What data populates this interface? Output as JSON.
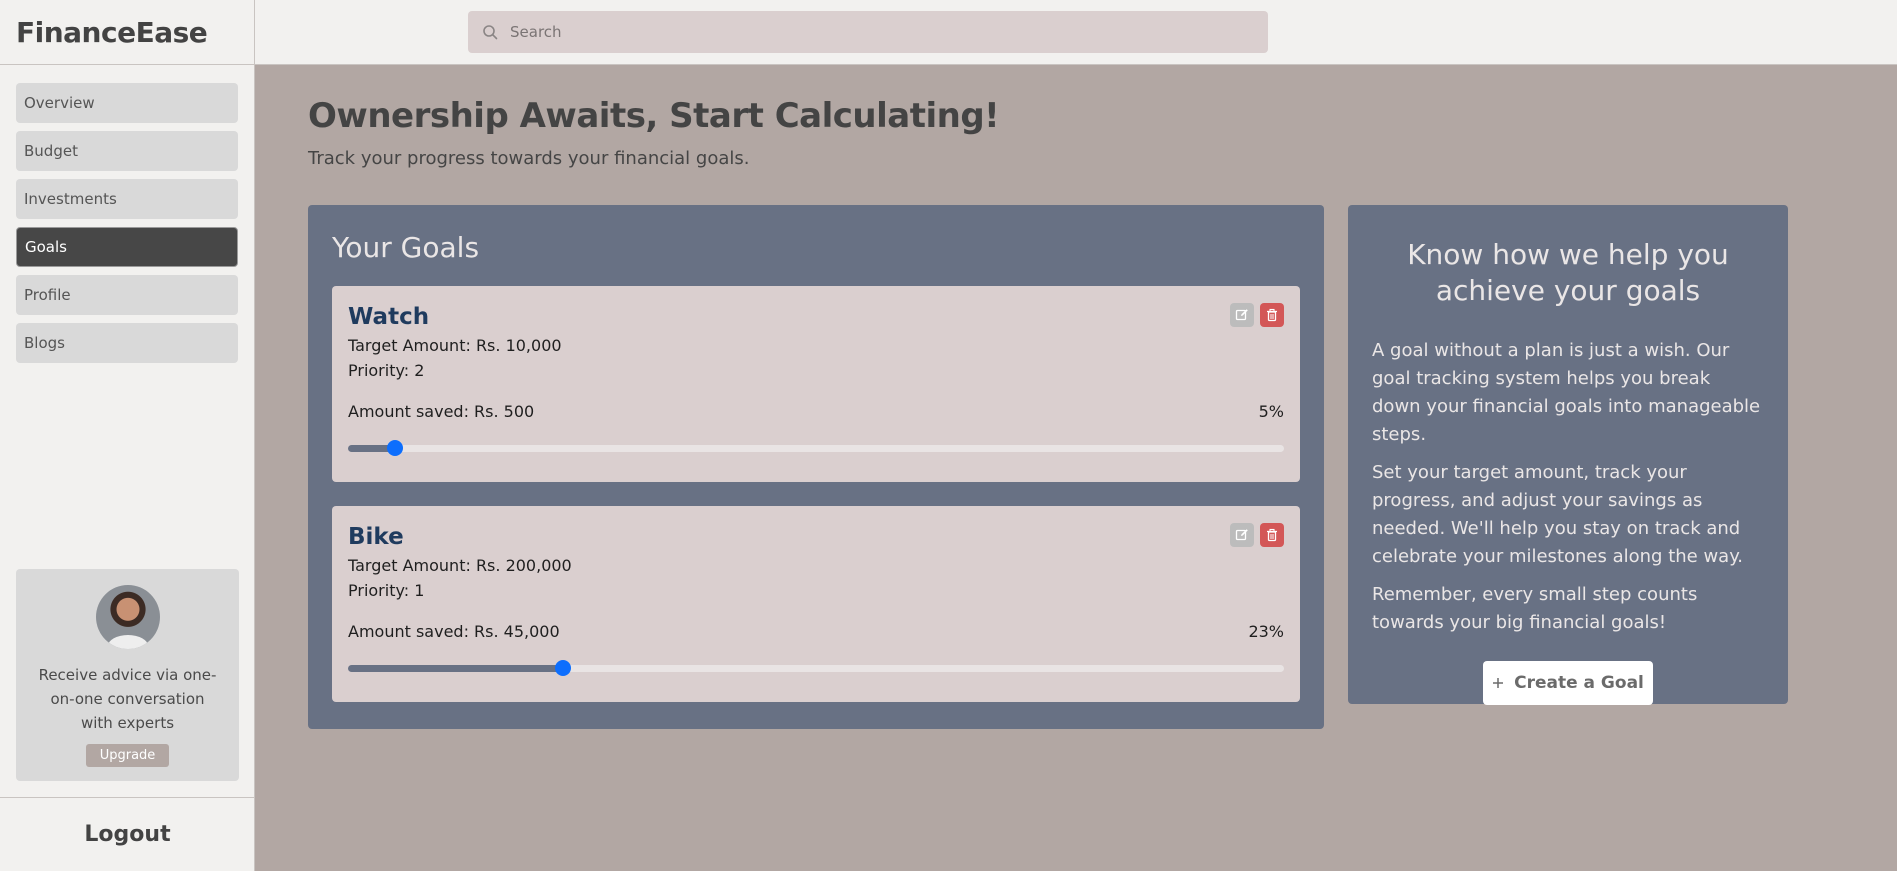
{
  "app": {
    "brand": "FinanceEase"
  },
  "sidebar": {
    "items": [
      {
        "label": "Overview",
        "active": false
      },
      {
        "label": "Budget",
        "active": false
      },
      {
        "label": "Investments",
        "active": false
      },
      {
        "label": "Goals",
        "active": true
      },
      {
        "label": "Profile",
        "active": false
      },
      {
        "label": "Blogs",
        "active": false
      }
    ],
    "promo": {
      "text": "Receive advice via one-on-one conversation with experts",
      "button": "Upgrade"
    },
    "logout": "Logout"
  },
  "search": {
    "placeholder": "Search"
  },
  "page": {
    "title": "Ownership Awaits, Start Calculating!",
    "subtitle": "Track your progress towards your financial goals."
  },
  "goals": {
    "heading": "Your Goals",
    "items": [
      {
        "name": "Watch",
        "target": "Target Amount: Rs. 10,000",
        "priority": "Priority: 2",
        "saved": "Amount saved: Rs. 500",
        "percent_label": "5%",
        "progress": 0.05
      },
      {
        "name": "Bike",
        "target": "Target Amount: Rs. 200,000",
        "priority": "Priority: 1",
        "saved": "Amount saved: Rs. 45,000",
        "percent_label": "23%",
        "progress": 0.23
      }
    ]
  },
  "info": {
    "title": "Know how we help you achieve your goals",
    "paragraphs": [
      "A goal without a plan is just a wish. Our goal tracking system helps you break down your financial goals into manageable steps.",
      "Set your target amount, track your progress, and adjust your savings as needed. We'll help you stay on track and celebrate your milestones along the way.",
      "Remember, every small step counts towards your big financial goals!"
    ],
    "button": "Create a Goal"
  },
  "colors": {
    "panel": "#687184",
    "slider_thumb": "#0d6efd",
    "delete": "#d35757"
  }
}
